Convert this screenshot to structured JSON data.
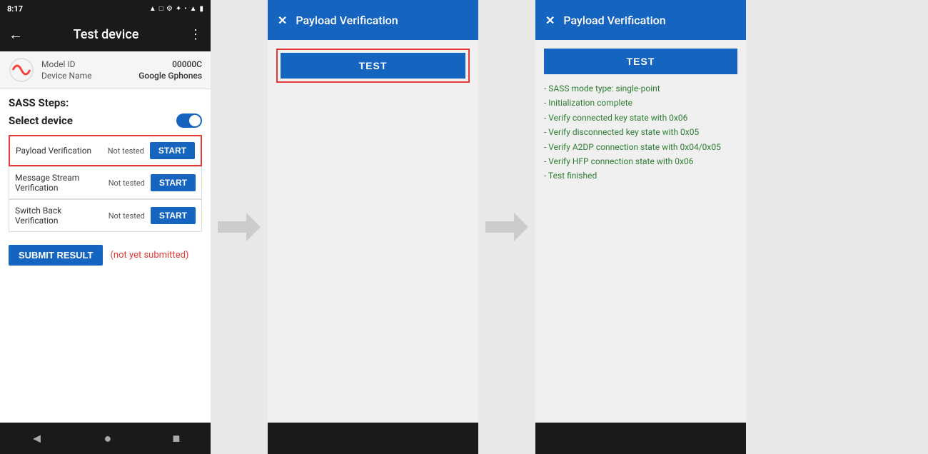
{
  "phone": {
    "status_bar": {
      "time": "8:17",
      "icons": "▲ □ ⚙ ✦ •"
    },
    "top_bar": {
      "title": "Test device",
      "back_icon": "←",
      "menu_icon": "⋮"
    },
    "device_info": {
      "model_id_label": "Model ID",
      "model_id_value": "00000C",
      "device_name_label": "Device Name",
      "device_name_value": "Google Gphones"
    },
    "sass_steps_title": "SASS Steps:",
    "select_device_label": "Select device",
    "steps": [
      {
        "name": "Payload Verification",
        "status": "Not tested",
        "button": "START",
        "highlighted": true
      },
      {
        "name": "Message Stream Verification",
        "status": "Not tested",
        "button": "START",
        "highlighted": false
      },
      {
        "name": "Switch Back Verification",
        "status": "Not tested",
        "button": "START",
        "highlighted": false
      }
    ],
    "submit_button": "SUBMIT RESULT",
    "submit_status": "(not yet submitted)",
    "nav": {
      "back": "◄",
      "home": "●",
      "square": "■"
    }
  },
  "dialog1": {
    "header": {
      "close_icon": "✕",
      "title": "Payload Verification"
    },
    "test_button_label": "TEST",
    "has_border": true
  },
  "dialog2": {
    "header": {
      "close_icon": "✕",
      "title": "Payload Verification"
    },
    "test_button_label": "TEST",
    "has_border": false,
    "results": [
      "- SASS mode type: single-point",
      "- Initialization complete",
      "- Verify connected key state with 0x06",
      "- Verify disconnected key state with 0x05",
      "- Verify A2DP connection state with 0x04/0x05",
      "- Verify HFP connection state with 0x06",
      "- Test finished"
    ]
  }
}
